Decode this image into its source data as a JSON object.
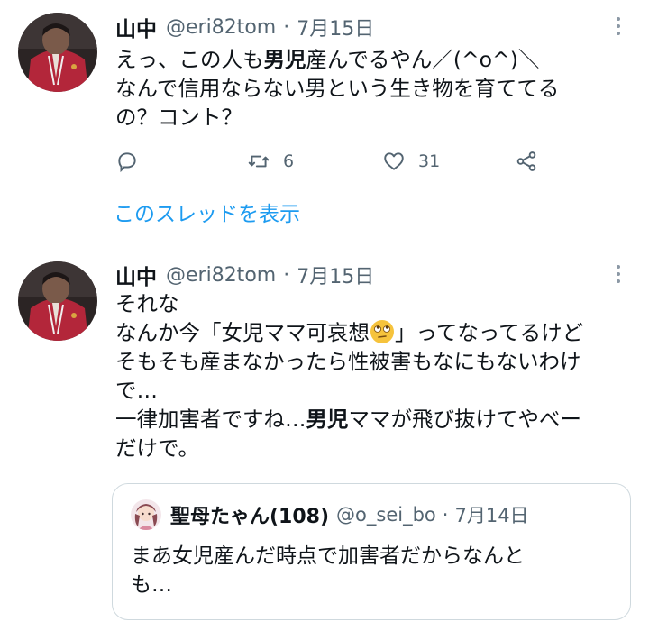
{
  "tweets": [
    {
      "author": {
        "name": "山中",
        "handle": "@eri82tom"
      },
      "date": "7月15日",
      "text": {
        "line1_pre": "えっ、この人も",
        "line1_bold": "男児",
        "line1_post": "産んでるやん／(^o^)＼",
        "line2": "なんで信用ならない男という生き物を育ててる",
        "line3": "の？コント？"
      },
      "stats": {
        "retweets": "6",
        "likes": "31"
      },
      "show_thread": "このスレッドを表示"
    },
    {
      "author": {
        "name": "山中",
        "handle": "@eri82tom"
      },
      "date": "7月15日",
      "text": {
        "line1": "それな",
        "line2_pre": "なんか今「女児ママ可哀想",
        "line2_emoji": "face-with-rolling-eyes-emoji",
        "line2_post": "」ってなってるけど",
        "line3": "そもそも産まなかったら性被害もなにもないわけ",
        "line4": "で…",
        "line5_pre": "一律加害者ですね…",
        "line5_bold": "男児",
        "line5_post": "ママが飛び抜けてやべー",
        "line6": "だけで。"
      },
      "quote": {
        "author": {
          "name": "聖母たゃん(108)",
          "handle": "@o_sei_bo"
        },
        "date": "7月14日",
        "line1": "まあ女児産んだ時点で加害者だからなんと",
        "line2": "も…"
      }
    }
  ],
  "icons": {
    "more": "more-dots-icon",
    "reply": "reply-icon",
    "retweet": "retweet-icon",
    "like": "heart-icon",
    "share": "share-icon"
  },
  "colors": {
    "accent": "#1d9bf0",
    "secondary_text": "#536471",
    "border": "#cfd9de"
  }
}
